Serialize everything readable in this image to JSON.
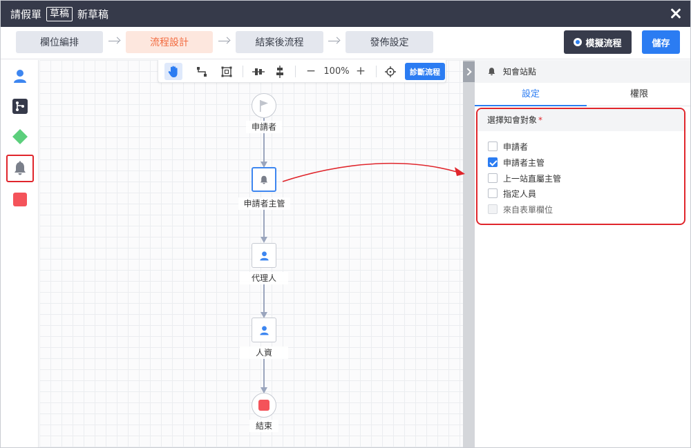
{
  "window": {
    "title": "請假單",
    "status_badge": "草稿",
    "doc_name": "新草稿"
  },
  "steps": [
    {
      "label": "欄位編排",
      "active": false
    },
    {
      "label": "流程設計",
      "active": true
    },
    {
      "label": "結案後流程",
      "active": false
    },
    {
      "label": "發佈設定",
      "active": false
    }
  ],
  "actions": {
    "simulate_label": "模擬流程",
    "save_label": "儲存"
  },
  "palette": [
    {
      "name": "person-icon",
      "color": "#3d86f0"
    },
    {
      "name": "branch-icon",
      "color": "#363a4a"
    },
    {
      "name": "diamond-icon",
      "color": "#5ccf7c"
    },
    {
      "name": "bell-icon",
      "color": "#7a7f8a"
    },
    {
      "name": "stop-square-icon",
      "color": "#f4535a"
    }
  ],
  "toolbar": {
    "zoom": "100%",
    "diagnose_label": "診斷流程"
  },
  "flow": {
    "nodes": [
      {
        "label": "申請者",
        "icon": "flag-icon"
      },
      {
        "label": "申請者主管",
        "icon": "bell-icon",
        "selected": true
      },
      {
        "label": "代理人",
        "icon": "person-icon"
      },
      {
        "label": "人資",
        "icon": "person-icon"
      },
      {
        "label": "結束",
        "icon": "stop-square-icon"
      }
    ]
  },
  "panel": {
    "header": "知會站點",
    "tabs": [
      {
        "label": "設定",
        "active": true
      },
      {
        "label": "權限",
        "active": false
      }
    ],
    "section_title": "選擇知會對象",
    "required_mark": "*",
    "options": [
      {
        "label": "申請者",
        "checked": false,
        "disabled": false
      },
      {
        "label": "申請者主管",
        "checked": true,
        "disabled": false
      },
      {
        "label": "上一站直屬主管",
        "checked": false,
        "disabled": false
      },
      {
        "label": "指定人員",
        "checked": false,
        "disabled": false
      },
      {
        "label": "來自表單欄位",
        "checked": false,
        "disabled": true
      }
    ]
  },
  "colors": {
    "titlebar": "#363a4a",
    "primary": "#2b7cf2",
    "active_step_text": "#f26a3e",
    "highlight": "#e0252b"
  }
}
